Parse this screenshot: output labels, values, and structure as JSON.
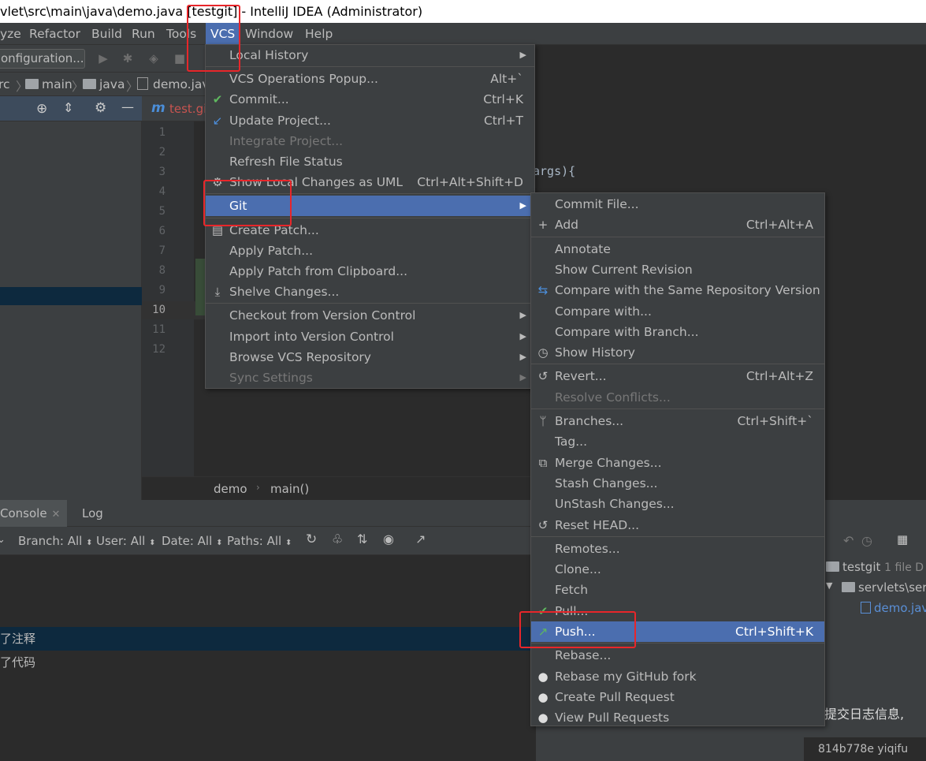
{
  "window": {
    "title": "vlet\\src\\main\\java\\demo.java [testgit] - IntelliJ IDEA (Administrator)"
  },
  "menubar": {
    "items": [
      "yze",
      "Refactor",
      "Build",
      "Run",
      "Tools",
      "VCS",
      "Window",
      "Help"
    ]
  },
  "toolbar": {
    "config_label": "onfiguration..."
  },
  "navbar": {
    "crumbs": [
      "rc",
      "main",
      "java",
      "demo.jav"
    ]
  },
  "editor_tab": {
    "label": "test.gi"
  },
  "editor": {
    "line_numbers": [
      "1",
      "2",
      "3",
      "4",
      "5",
      "6",
      "7",
      "8",
      "9",
      "10",
      "11",
      "12"
    ],
    "code_fragment": "args){",
    "breadcrumb": [
      "demo",
      "main()"
    ]
  },
  "bottom": {
    "tabs": [
      "Console",
      "Log"
    ],
    "filters": [
      "Branch: All",
      "User: All",
      "Date: All",
      "Paths: All"
    ],
    "log_rows": [
      "了注释",
      "了代码"
    ],
    "right": {
      "repo": "testgit",
      "count": "1 file D",
      "folder": "servlets\\ser",
      "file": "demo.jav",
      "commit_msg": "提交日志信息,",
      "hash": "814b778e yiqifu"
    }
  },
  "vcs_menu": {
    "items": [
      {
        "label": "Local History",
        "u": "H",
        "submenu": true
      },
      {
        "sep": true
      },
      {
        "label": "VCS Operations Popup...",
        "shortcut": "Alt+`"
      },
      {
        "label": "Commit...",
        "shortcut": "Ctrl+K",
        "icon": "check"
      },
      {
        "label": "Update Project...",
        "shortcut": "Ctrl+T",
        "icon": "update"
      },
      {
        "label": "Integrate Project...",
        "disabled": true
      },
      {
        "label": "Refresh File Status"
      },
      {
        "label": "Show Local Changes as UML",
        "shortcut": "Ctrl+Alt+Shift+D",
        "icon": "uml"
      },
      {
        "sep": true
      },
      {
        "label": "Git",
        "submenu": true,
        "selected": true
      },
      {
        "sep": true
      },
      {
        "label": "Create Patch...",
        "icon": "patch"
      },
      {
        "label": "Apply Patch..."
      },
      {
        "label": "Apply Patch from Clipboard..."
      },
      {
        "label": "Shelve Changes...",
        "icon": "shelve"
      },
      {
        "sep": true
      },
      {
        "label": "Checkout from Version Control",
        "submenu": true
      },
      {
        "label": "Import into Version Control",
        "submenu": true
      },
      {
        "label": "Browse VCS Repository",
        "submenu": true
      },
      {
        "label": "Sync Settings",
        "submenu": true,
        "disabled": true
      }
    ]
  },
  "git_menu": {
    "items": [
      {
        "label": "Commit File..."
      },
      {
        "label": "Add",
        "shortcut": "Ctrl+Alt+A",
        "icon": "+"
      },
      {
        "sep": true
      },
      {
        "label": "Annotate"
      },
      {
        "label": "Show Current Revision"
      },
      {
        "label": "Compare with the Same Repository Version",
        "icon": "compare"
      },
      {
        "label": "Compare with..."
      },
      {
        "label": "Compare with Branch..."
      },
      {
        "label": "Show History",
        "icon": "history"
      },
      {
        "sep": true
      },
      {
        "label": "Revert...",
        "shortcut": "Ctrl+Alt+Z",
        "icon": "revert"
      },
      {
        "label": "Resolve Conflicts...",
        "disabled": true
      },
      {
        "sep": true
      },
      {
        "label": "Branches...",
        "shortcut": "Ctrl+Shift+`",
        "icon": "branch"
      },
      {
        "label": "Tag..."
      },
      {
        "label": "Merge Changes...",
        "icon": "merge"
      },
      {
        "label": "Stash Changes..."
      },
      {
        "label": "UnStash Changes..."
      },
      {
        "label": "Reset HEAD...",
        "icon": "revert"
      },
      {
        "sep": true
      },
      {
        "label": "Remotes..."
      },
      {
        "label": "Clone..."
      },
      {
        "label": "Fetch"
      },
      {
        "label": "Pull...",
        "icon": "check"
      },
      {
        "label": "Push...",
        "shortcut": "Ctrl+Shift+K",
        "icon": "push",
        "selected": true
      },
      {
        "sep": true
      },
      {
        "label": "Rebase..."
      },
      {
        "label": "Rebase my GitHub fork",
        "icon": "github"
      },
      {
        "label": "Create Pull Request",
        "icon": "github"
      },
      {
        "label": "View Pull Requests",
        "icon": "github"
      }
    ]
  },
  "colors": {
    "highlight": "#4b6eaf",
    "annotation": "#e8262a",
    "menu_bg": "#3c3f41"
  }
}
